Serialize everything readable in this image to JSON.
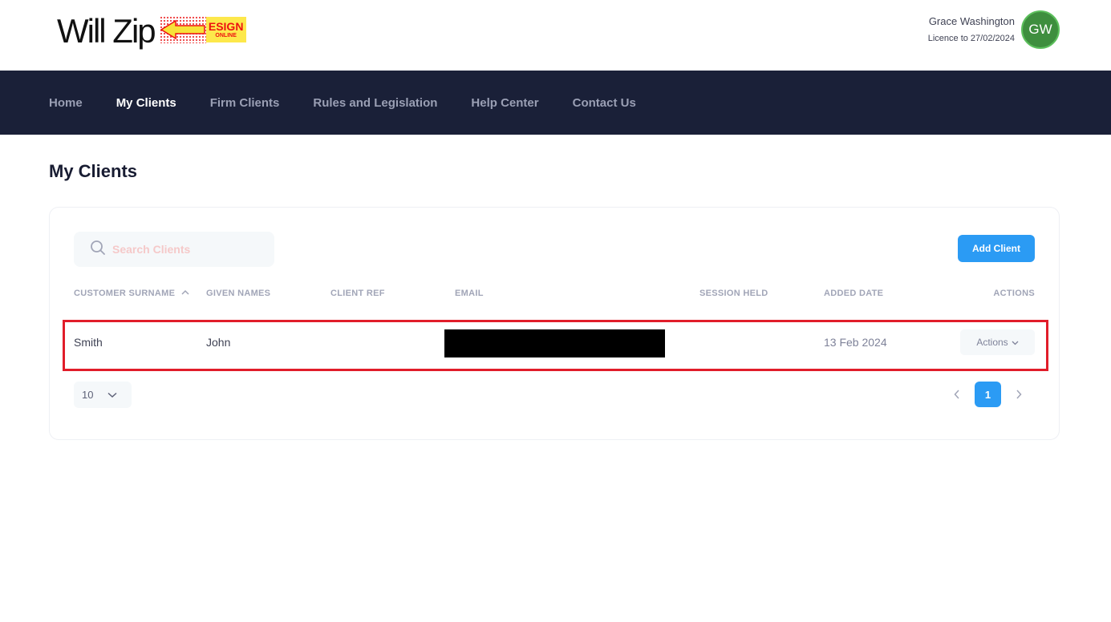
{
  "brand": {
    "logo_text": "Will Zip",
    "badge_main": "ESIGN",
    "badge_sub": "ONLINE"
  },
  "user": {
    "name": "Grace Washington",
    "licence": "Licence to 27/02/2024",
    "initials": "GW",
    "avatar_color": "#3e8e3e"
  },
  "nav": {
    "items": [
      {
        "label": "Home",
        "active": false
      },
      {
        "label": "My Clients",
        "active": true
      },
      {
        "label": "Firm Clients",
        "active": false
      },
      {
        "label": "Rules and Legislation",
        "active": false
      },
      {
        "label": "Help Center",
        "active": false
      },
      {
        "label": "Contact Us",
        "active": false
      }
    ]
  },
  "page": {
    "title": "My Clients"
  },
  "toolbar": {
    "search_placeholder": "Search Clients",
    "add_label": "Add Client",
    "accent": "#2b9bf4"
  },
  "table": {
    "headers": [
      "CUSTOMER SURNAME",
      "GIVEN NAMES",
      "CLIENT REF",
      "EMAIL",
      "SESSION HELD",
      "ADDED DATE",
      "ACTIONS"
    ],
    "sorted_column": "CUSTOMER SURNAME",
    "rows": [
      {
        "surname": "Smith",
        "given": "John",
        "ref": "",
        "email": "",
        "session": "",
        "added": "13 Feb 2024",
        "actions_label": "Actions"
      }
    ]
  },
  "pagination": {
    "page_size": "10",
    "current_page": "1"
  },
  "highlight_color": "#e11d2a"
}
